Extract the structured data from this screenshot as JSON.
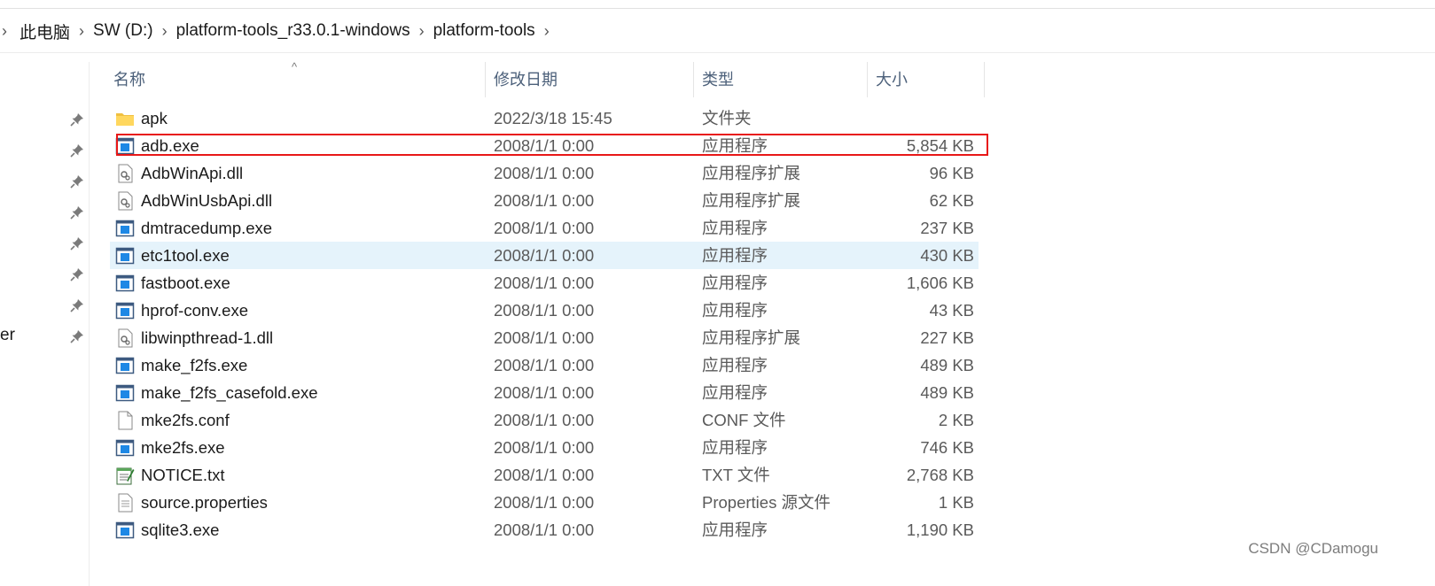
{
  "breadcrumb": {
    "items": [
      "此电脑",
      "SW (D:)",
      "platform-tools_r33.0.1-windows",
      "platform-tools"
    ]
  },
  "nav": {
    "partial_text": "er"
  },
  "columns": {
    "name": "名称",
    "date": "修改日期",
    "type": "类型",
    "size": "大小"
  },
  "sort_indicator": "^",
  "files": [
    {
      "name": "apk",
      "date": "2022/3/18 15:45",
      "type": "文件夹",
      "size": "",
      "icon": "folder-icon"
    },
    {
      "name": "adb.exe",
      "date": "2008/1/1 0:00",
      "type": "应用程序",
      "size": "5,854 KB",
      "icon": "application-icon"
    },
    {
      "name": "AdbWinApi.dll",
      "date": "2008/1/1 0:00",
      "type": "应用程序扩展",
      "size": "96 KB",
      "icon": "dll-icon"
    },
    {
      "name": "AdbWinUsbApi.dll",
      "date": "2008/1/1 0:00",
      "type": "应用程序扩展",
      "size": "62 KB",
      "icon": "dll-icon"
    },
    {
      "name": "dmtracedump.exe",
      "date": "2008/1/1 0:00",
      "type": "应用程序",
      "size": "237 KB",
      "icon": "application-icon"
    },
    {
      "name": "etc1tool.exe",
      "date": "2008/1/1 0:00",
      "type": "应用程序",
      "size": "430 KB",
      "icon": "application-icon"
    },
    {
      "name": "fastboot.exe",
      "date": "2008/1/1 0:00",
      "type": "应用程序",
      "size": "1,606 KB",
      "icon": "application-icon"
    },
    {
      "name": "hprof-conv.exe",
      "date": "2008/1/1 0:00",
      "type": "应用程序",
      "size": "43 KB",
      "icon": "application-icon"
    },
    {
      "name": "libwinpthread-1.dll",
      "date": "2008/1/1 0:00",
      "type": "应用程序扩展",
      "size": "227 KB",
      "icon": "dll-icon"
    },
    {
      "name": "make_f2fs.exe",
      "date": "2008/1/1 0:00",
      "type": "应用程序",
      "size": "489 KB",
      "icon": "application-icon"
    },
    {
      "name": "make_f2fs_casefold.exe",
      "date": "2008/1/1 0:00",
      "type": "应用程序",
      "size": "489 KB",
      "icon": "application-icon"
    },
    {
      "name": "mke2fs.conf",
      "date": "2008/1/1 0:00",
      "type": "CONF 文件",
      "size": "2 KB",
      "icon": "blank-file-icon"
    },
    {
      "name": "mke2fs.exe",
      "date": "2008/1/1 0:00",
      "type": "应用程序",
      "size": "746 KB",
      "icon": "application-icon"
    },
    {
      "name": "NOTICE.txt",
      "date": "2008/1/1 0:00",
      "type": "TXT 文件",
      "size": "2,768 KB",
      "icon": "notepad-icon"
    },
    {
      "name": "source.properties",
      "date": "2008/1/1 0:00",
      "type": "Properties 源文件",
      "size": "1 KB",
      "icon": "text-file-icon"
    },
    {
      "name": "sqlite3.exe",
      "date": "2008/1/1 0:00",
      "type": "应用程序",
      "size": "1,190 KB",
      "icon": "application-icon"
    }
  ],
  "hovered_file": "etc1tool.exe",
  "highlighted_file": "adb.exe",
  "highlight_color": "#e81717",
  "hover_color": "#e5f3fb",
  "watermark": "CSDN @CDamogu"
}
